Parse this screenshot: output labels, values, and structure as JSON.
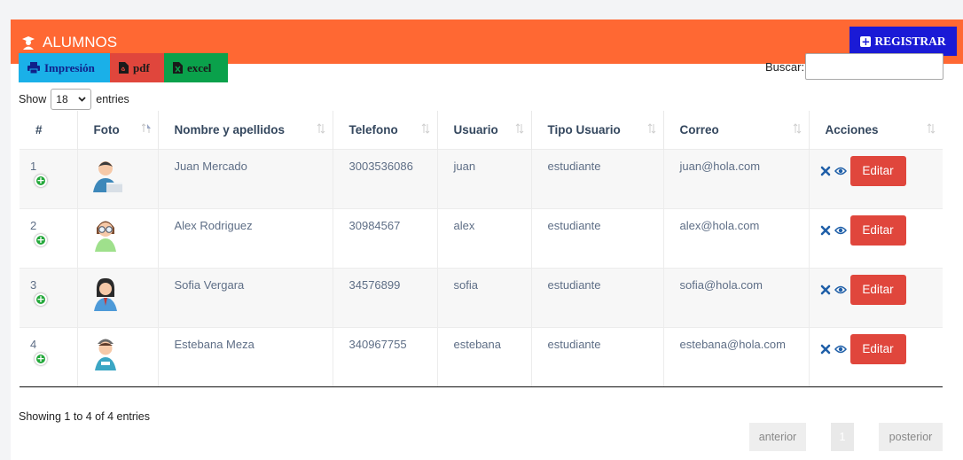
{
  "header": {
    "title": "ALUMNOS",
    "register_label": "REGISTRAR"
  },
  "export": {
    "print_label": "Impresión",
    "pdf_label": "pdf",
    "excel_label": "excel"
  },
  "search": {
    "label": "Buscar:",
    "value": ""
  },
  "length": {
    "show": "Show",
    "value": "18",
    "entries": "entries"
  },
  "columns": [
    "#",
    "Foto",
    "Nombre y apellidos",
    "Telefono",
    "Usuario",
    "Tipo Usuario",
    "Correo",
    "Acciones"
  ],
  "rows": [
    {
      "num": "1",
      "name": "Juan Mercado",
      "phone": "3003536086",
      "user": "juan",
      "type": "estudiante",
      "email": "juan@hola.com",
      "edit": "Editar",
      "avatar": "man-laptop-icon"
    },
    {
      "num": "2",
      "name": "Alex Rodriguez",
      "phone": "30984567",
      "user": "alex",
      "type": "estudiante",
      "email": "alex@hola.com",
      "edit": "Editar",
      "avatar": "boy-glasses-icon"
    },
    {
      "num": "3",
      "name": "Sofia Vergara",
      "phone": "34576899",
      "user": "sofia",
      "type": "estudiante",
      "email": "sofia@hola.com",
      "edit": "Editar",
      "avatar": "woman-tie-icon"
    },
    {
      "num": "4",
      "name": "Estebana Meza",
      "phone": "340967755",
      "user": "estebana",
      "type": "estudiante",
      "email": "estebana@hola.com",
      "edit": "Editar",
      "avatar": "nurse-icon"
    }
  ],
  "footer": {
    "info": "Showing 1 to 4 of 4 entries",
    "prev": "anterior",
    "page": "1",
    "next": "posterior"
  },
  "colors": {
    "header": "#ff6833",
    "register": "#1a1ad6",
    "edit": "#e0463c",
    "print": "#1ab0e8",
    "excel": "#0aa14b"
  }
}
